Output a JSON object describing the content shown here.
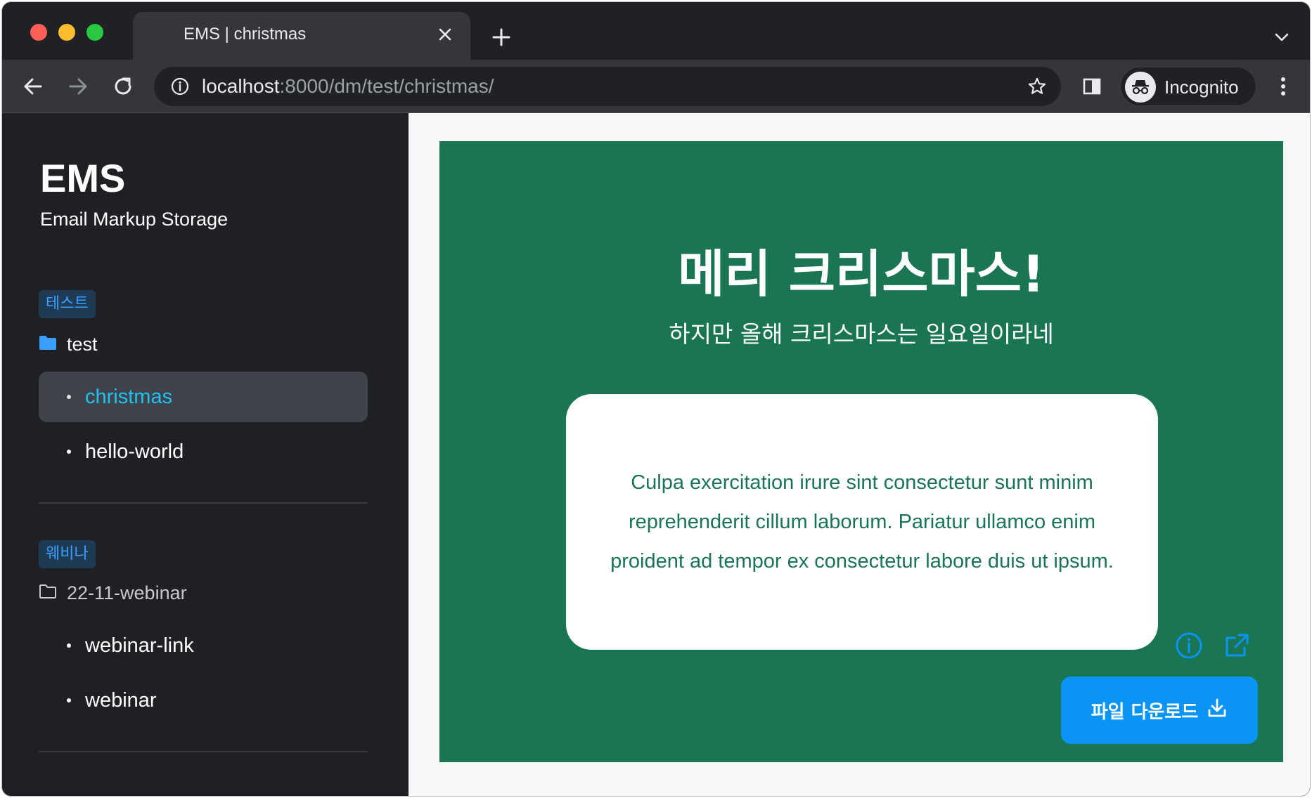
{
  "browser": {
    "tab_title": "EMS | christmas",
    "url_host": "localhost",
    "url_path": ":8000/dm/test/christmas/",
    "profile_label": "Incognito"
  },
  "sidebar": {
    "brand": "EMS",
    "subtitle": "Email Markup Storage",
    "groups": [
      {
        "badge": "테스트",
        "folder": "test",
        "items": [
          {
            "label": "christmas",
            "active": true
          },
          {
            "label": "hello-world",
            "active": false
          }
        ]
      },
      {
        "badge": "웨비나",
        "folder": "22-11-webinar",
        "items": [
          {
            "label": "webinar-link",
            "active": false
          },
          {
            "label": "webinar",
            "active": false
          }
        ]
      }
    ]
  },
  "email": {
    "title": "메리 크리스마스!",
    "subtitle": "하지만 올해 크리스마스는 일요일이라네",
    "body": "Culpa exercitation irure sint consectetur sunt minim reprehenderit cillum laborum. Pariatur ullamco enim proident ad tempor ex consectetur labore duis ut ipsum.",
    "download_label": "파일 다운로드"
  },
  "colors": {
    "email_background": "#1a7553",
    "download_button": "#0a95f6",
    "active_nav_text": "#22c1ee",
    "badge_text": "#3aa0ff"
  },
  "icons": {
    "info": "info-circle-icon",
    "open_external": "external-link-icon",
    "download": "download-icon",
    "folder_filled": "folder-filled-icon",
    "folder_outline": "folder-outline-icon"
  }
}
